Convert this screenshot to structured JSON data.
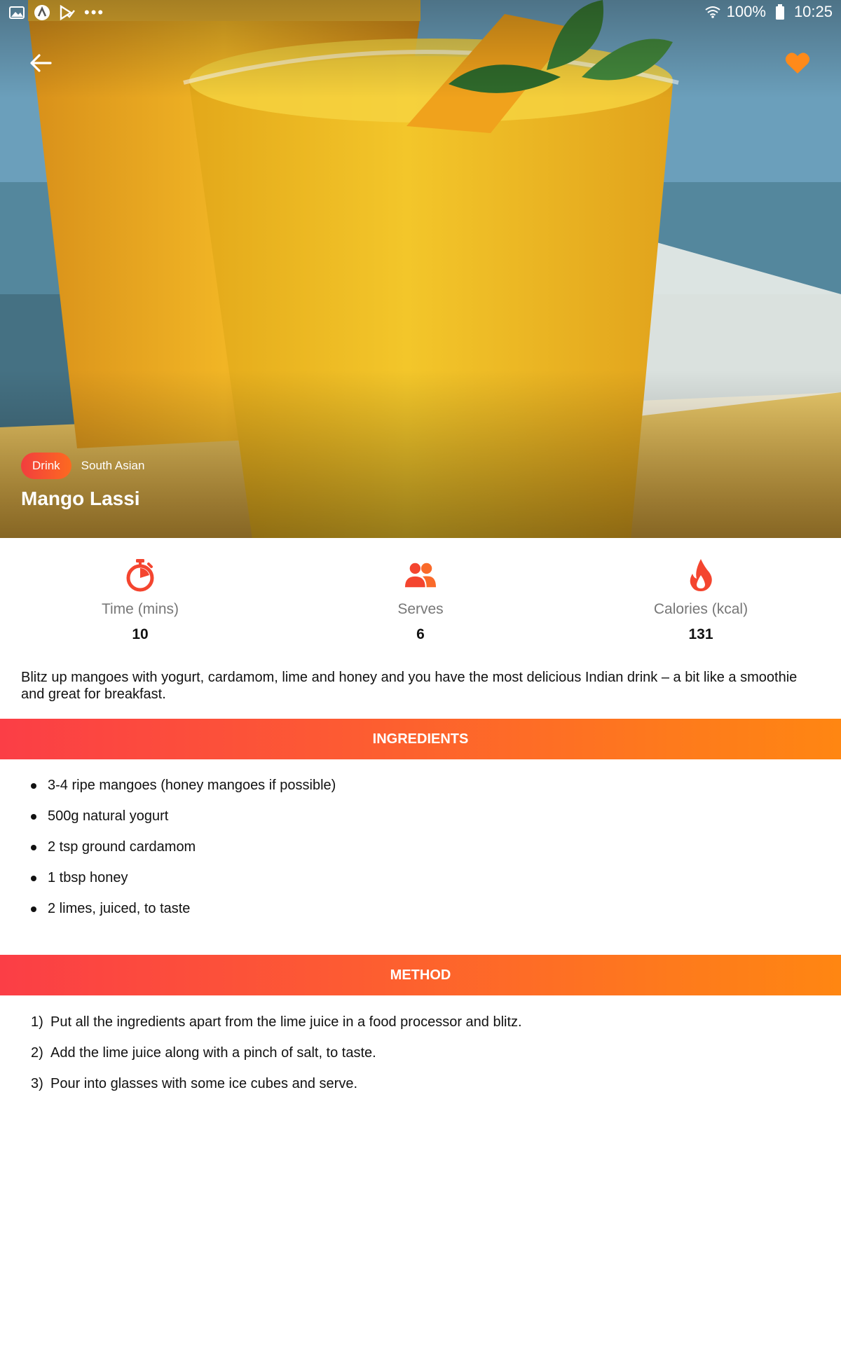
{
  "status_bar": {
    "battery": "100%",
    "time": "10:25",
    "left_icons": [
      "image-icon",
      "a-badge-icon",
      "play-check-icon",
      "more-dots-icon"
    ]
  },
  "hero": {
    "back_icon": "arrow-back-icon",
    "favorite_icon": "heart-icon",
    "category": "Drink",
    "cuisine": "South Asian",
    "title": "Mango Lassi"
  },
  "stats": [
    {
      "icon": "timer-icon",
      "label": "Time (mins)",
      "value": "10"
    },
    {
      "icon": "people-icon",
      "label": "Serves",
      "value": "6"
    },
    {
      "icon": "flame-icon",
      "label": "Calories (kcal)",
      "value": "131"
    }
  ],
  "description": "Blitz up mangoes with yogurt, cardamom, lime and honey and you have the most delicious Indian drink – a bit like a smoothie and great for breakfast.",
  "ingredients": {
    "header": "INGREDIENTS",
    "items": [
      "3-4 ripe mangoes (honey mangoes if possible)",
      "500g natural yogurt",
      "2 tsp ground cardamom",
      "1 tbsp honey",
      "2 limes, juiced, to taste"
    ]
  },
  "method": {
    "header": "METHOD",
    "steps": [
      {
        "num": "1)",
        "text": "Put all the ingredients apart from the lime juice in a food processor and blitz."
      },
      {
        "num": "2)",
        "text": "Add the lime juice along with a pinch of salt, to taste."
      },
      {
        "num": "3)",
        "text": "Pour into glasses with some ice cubes and serve."
      }
    ]
  },
  "colors": {
    "accent_start": "#fb3e46",
    "accent_end": "#ff8612",
    "favorite": "#ff8a1a",
    "icon_orange": "#f4452f"
  }
}
